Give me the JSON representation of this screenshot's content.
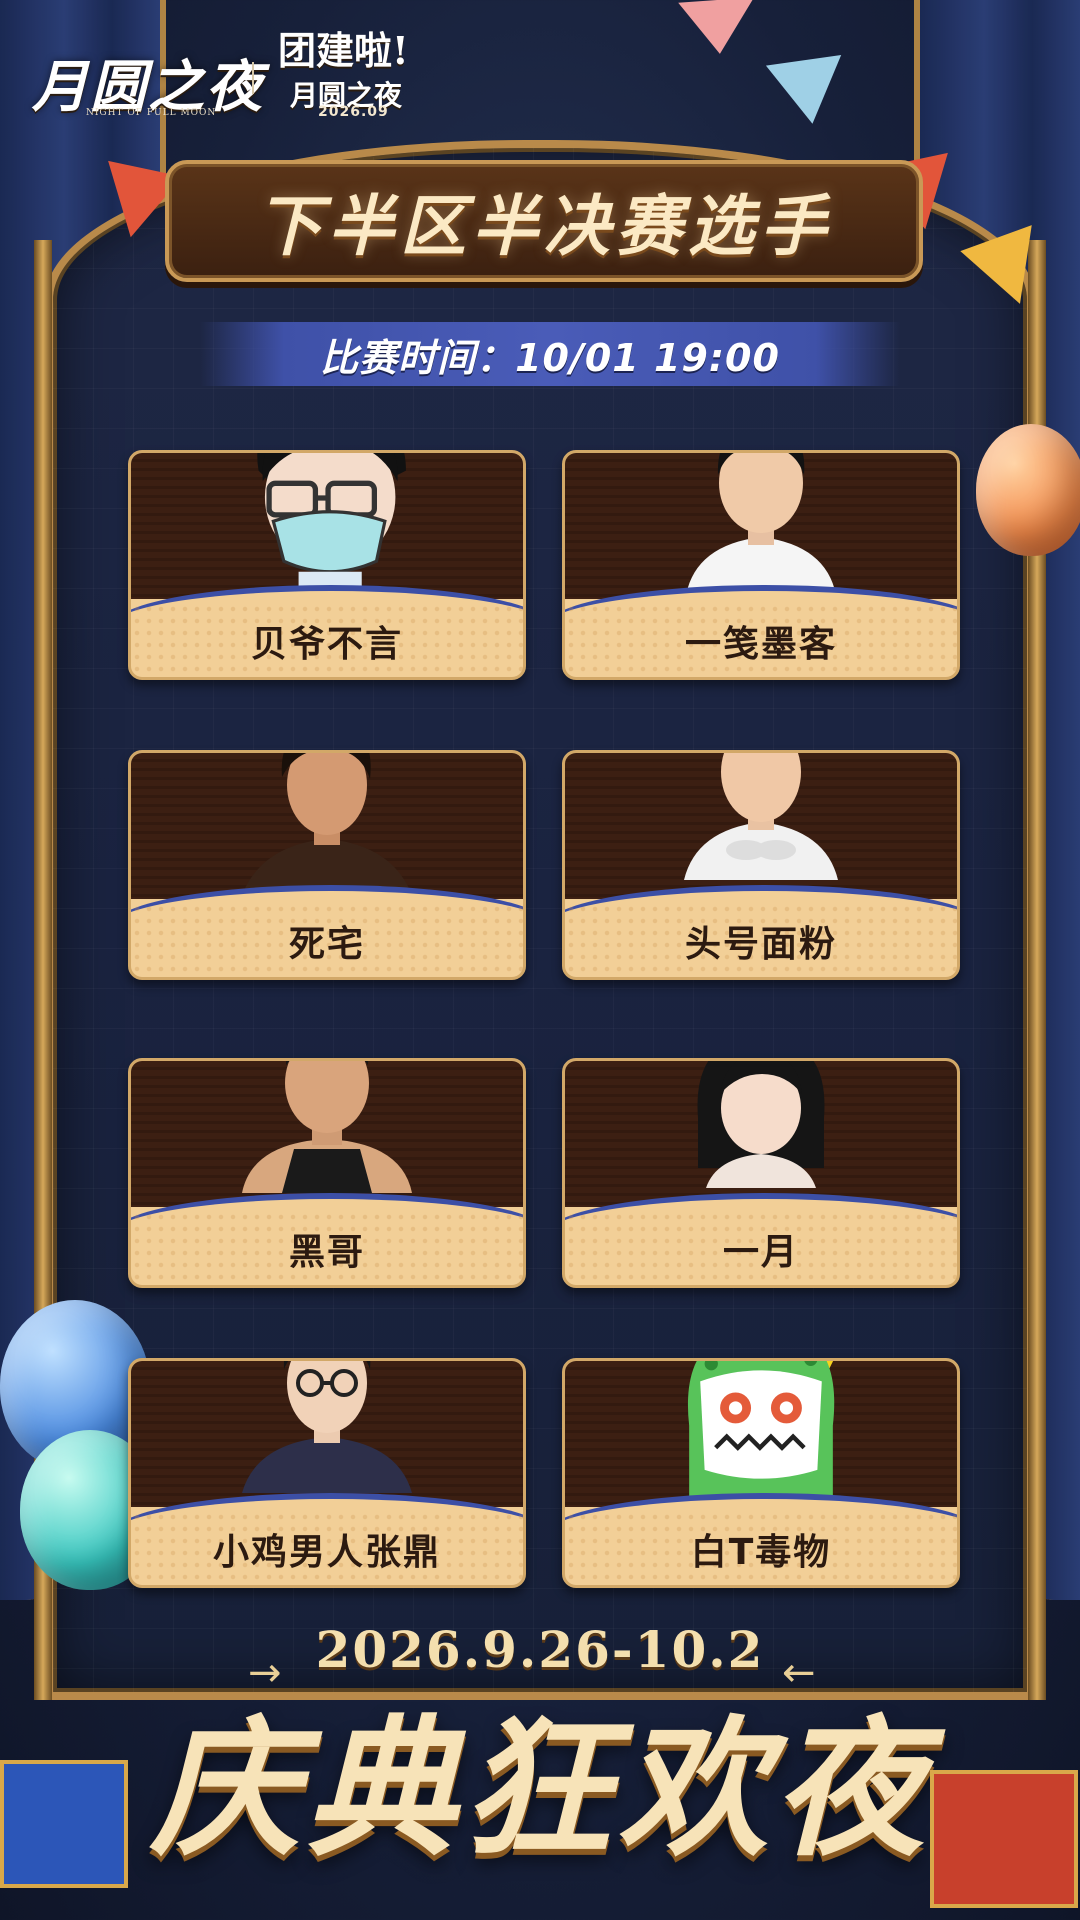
{
  "logo": {
    "brand_name": "月圆之夜",
    "brand_subtitle": "NIGHT OF FULL MOON",
    "event_line1": "团建啦!",
    "event_line2": "月圆之夜",
    "event_date": "2026.09"
  },
  "title": "下半区半决赛选手",
  "match_time": "比赛时间：10/01 19:00",
  "players": [
    {
      "name": "贝爷不言",
      "avatar": "cartoon-glasses-mask-avatar"
    },
    {
      "name": "一笺墨客",
      "avatar": "photo-avatar"
    },
    {
      "name": "死宅",
      "avatar": "photo-avatar"
    },
    {
      "name": "头号面粉",
      "avatar": "photo-avatar"
    },
    {
      "name": "黑哥",
      "avatar": "photo-avatar"
    },
    {
      "name": "一月",
      "avatar": "photo-avatar"
    },
    {
      "name": "小鸡男人张鼎",
      "avatar": "photo-avatar"
    },
    {
      "name": "白T毒物",
      "avatar": "cartoon-green-dinosaur-avatar"
    }
  ],
  "footer": {
    "date_range": "2026.9.26-10.2",
    "slogan": "庆典狂欢夜"
  },
  "colors": {
    "background": "#17203a",
    "card_frame": "#d2a868",
    "card_top": "#3c1f12",
    "card_bottom": "#f2cf97",
    "ribbon": "#3f51a8",
    "title_text": "#fbe9c4"
  }
}
